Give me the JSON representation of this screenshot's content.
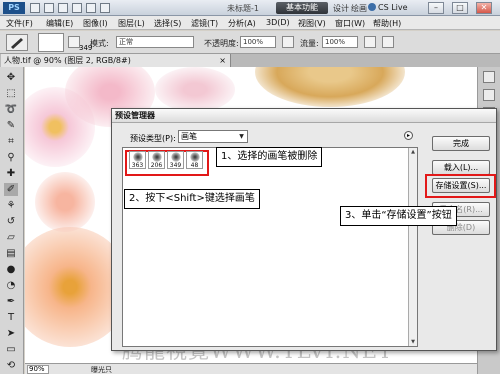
{
  "app": {
    "logo": "PS",
    "title": "未标题-1",
    "workspace_button": "基本功能",
    "workspace_link_design": "设计",
    "workspace_link_paint": "绘画",
    "cs_live": "CS Live",
    "win_min": "–",
    "win_max": "□",
    "win_close": "✕"
  },
  "menu": [
    "文件(F)",
    "编辑(E)",
    "图像(I)",
    "图层(L)",
    "选择(S)",
    "滤镜(T)",
    "分析(A)",
    "3D(D)",
    "视图(V)",
    "窗口(W)",
    "帮助(H)"
  ],
  "options": {
    "brush_size": "349",
    "mode_label": "模式:",
    "mode_value": "正常",
    "opacity_label": "不透明度:",
    "opacity_value": "100%",
    "flow_label": "流量:",
    "flow_value": "100%"
  },
  "document": {
    "tab": "人物.tif @ 90% (图层 2, RGB/8#)",
    "close": "×"
  },
  "status": {
    "zoom": "90%",
    "text": "曝光只"
  },
  "watermark": "腾龍視覺WWW.TLVI.NET",
  "dialog": {
    "title": "预设管理器",
    "preset_type_label": "预设类型(P):",
    "preset_type_value": "画笔",
    "brushes": [
      {
        "size": "363"
      },
      {
        "size": "206"
      },
      {
        "size": "349"
      },
      {
        "size": "48"
      }
    ],
    "buttons": {
      "done": "完成",
      "load": "载入(L)...",
      "save": "存储设置(S)...",
      "rename": "重命名(R)...",
      "delete": "删除(D)"
    }
  },
  "callouts": {
    "step1": "1、选择的画笔被删除",
    "step2": "2、按下<Shift>键选择画笔",
    "step3": "3、单击“存储设置”按钮"
  }
}
